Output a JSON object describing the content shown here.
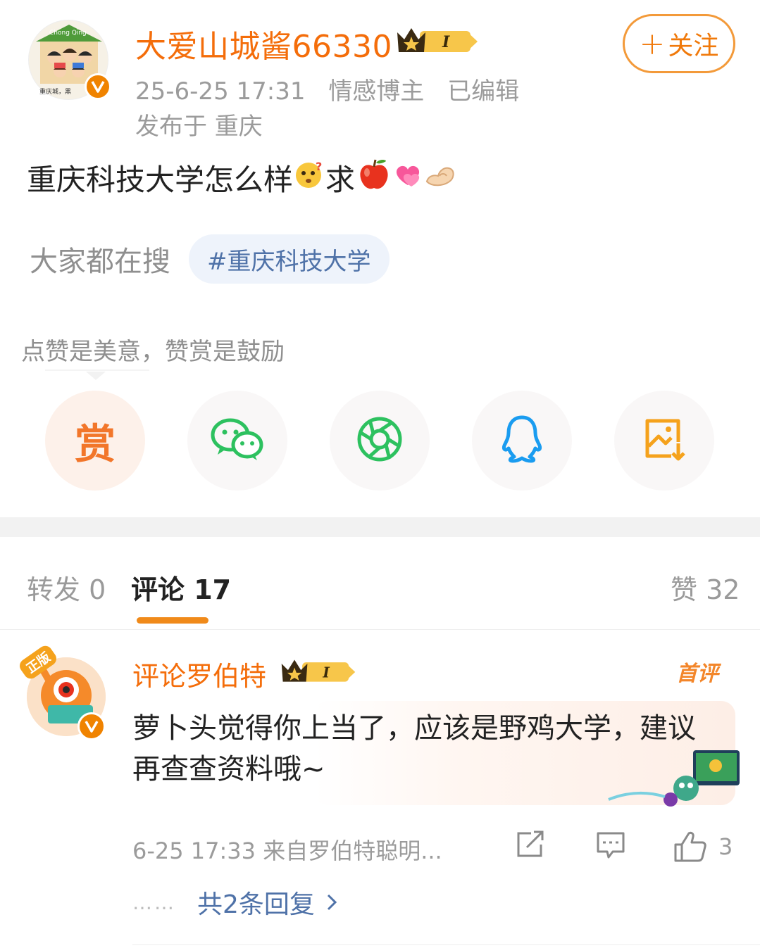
{
  "post": {
    "author": "大爱山城酱66330",
    "avatar_caption_top": "Chong Qing",
    "avatar_caption_bottom": "重庆城，黑",
    "vip_level": "I",
    "time": "25-6-25 17:31",
    "role": "情感博主",
    "edited": "已编辑",
    "location": "发布于 重庆",
    "follow_label": "关注",
    "text": "重庆科技大学怎么样",
    "text_tail": "求",
    "hot_search_label": "大家都在搜",
    "hot_search_tag": "#重庆科技大学",
    "reward_hint": "点赞是美意，赞赏是鼓励",
    "reward_button": "赏",
    "share_icons": [
      "reward-icon",
      "wechat-icon",
      "moments-icon",
      "qq-icon",
      "save-image-icon"
    ]
  },
  "tabs": [
    {
      "label": "转发 0",
      "active": false
    },
    {
      "label": "评论 17",
      "active": true
    },
    {
      "label": "赞 32",
      "active": false
    }
  ],
  "comment": {
    "author": "评论罗伯特",
    "avatar_badge": "正版",
    "vip_level": "I",
    "first_badge": "首评",
    "text": "萝卜头觉得你上当了，应该是野鸡大学，建议再查查资料哦~",
    "meta": "6-25 17:33 来自罗伯特聪明...",
    "like_count": "3",
    "replies_dots": "……",
    "replies_label": "共2条回复"
  },
  "colors": {
    "accent_orange": "#f46d0a",
    "link_blue": "#4f72a8",
    "meta_gray": "#9b9b9b",
    "wechat_green": "#2dc15f",
    "qq_blue": "#1a9cf0"
  }
}
